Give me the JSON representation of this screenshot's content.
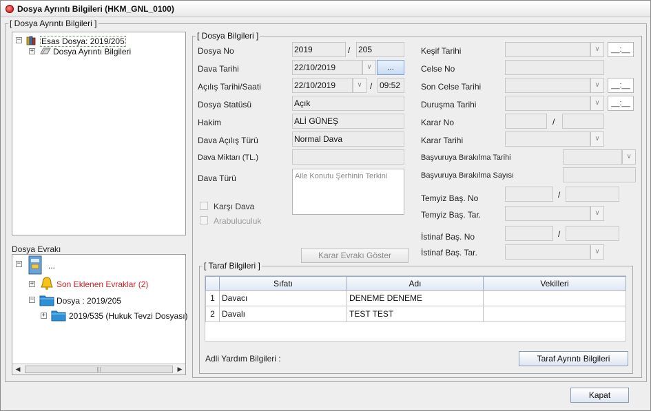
{
  "window": {
    "title": "Dosya Ayrıntı Bilgileri (HKM_GNL_0100)"
  },
  "outer_group": {
    "legend": "[ Dosya Ayrıntı Bilgileri ]"
  },
  "tree_top": {
    "root_label": "Esas Dosya: 2019/205",
    "child_label": "Dosya Ayrıntı Bilgileri"
  },
  "evrak": {
    "title": "Dosya Evrakı",
    "root_label": "...",
    "recent_label": "Son Eklenen Evraklar (2)",
    "dosya_label": "Dosya : 2019/205",
    "sub_label": "2019/535 (Hukuk Tevzi Dosyası)",
    "scroll_thumb": "|||"
  },
  "dosya_bilgileri": {
    "legend": "[ Dosya Bilgileri ]",
    "dosya_no_label": "Dosya No",
    "dosya_no_year": "2019",
    "dosya_no_num": "205",
    "dava_tarihi_label": "Dava Tarihi",
    "dava_tarihi": "22/10/2019",
    "dots_label": "...",
    "acilis_label": "Açılış Tarihi/Saati",
    "acilis_tarihi": "22/10/2019",
    "acilis_saati": "09:52",
    "statu_label": "Dosya Statüsü",
    "statu": "Açık",
    "hakim_label": "Hakim",
    "hakim": "ALİ GÜNEŞ",
    "acilis_turu_label": "Dava Açılış Türü",
    "acilis_turu": "Normal Dava",
    "miktar_label": "Dava Miktarı (TL.)",
    "miktar": "",
    "dava_turu_label": "Dava Türü",
    "dava_turu": "Aile Konutu Şerhinin Terkini",
    "karsi_dava_label": "Karşı Dava",
    "arabuluculuk_label": "Arabuluculuk",
    "karar_evraki_btn": "Karar Evrakı Göster",
    "kesif_label": "Keşif Tarihi",
    "celse_no_label": "Celse No",
    "son_celse_label": "Son Celse Tarihi",
    "durusma_label": "Duruşma Tarihi",
    "karar_no_label": "Karar No",
    "karar_tarihi_label": "Karar Tarihi",
    "basvuru_tarihi_label": "Başvuruya Bırakılma Tarihi",
    "basvuru_sayisi_label": "Başvuruya Bırakılma Sayısı",
    "temyiz_no_label": "Temyiz Baş. No",
    "temyiz_tar_label": "Temyiz Baş. Tar.",
    "istinaf_no_label": "İstinaf Baş. No",
    "istinaf_tar_label": "İstinaf Baş. Tar.",
    "time_placeholder": "__:__",
    "slash": "/"
  },
  "taraf": {
    "legend": "[ Taraf Bilgileri ]",
    "columns": [
      "Sıfatı",
      "Adı",
      "Vekilleri"
    ],
    "rows": [
      {
        "no": "1",
        "sifat": "Davacı",
        "adi": "DENEME DENEME",
        "vekil": ""
      },
      {
        "no": "2",
        "sifat": "Davalı",
        "adi": "TEST TEST",
        "vekil": ""
      }
    ],
    "adli_yardim_label": "Adli Yardım Bilgileri :",
    "taraf_btn": "Taraf Ayrıntı Bilgileri"
  },
  "footer": {
    "kapat_btn": "Kapat"
  }
}
